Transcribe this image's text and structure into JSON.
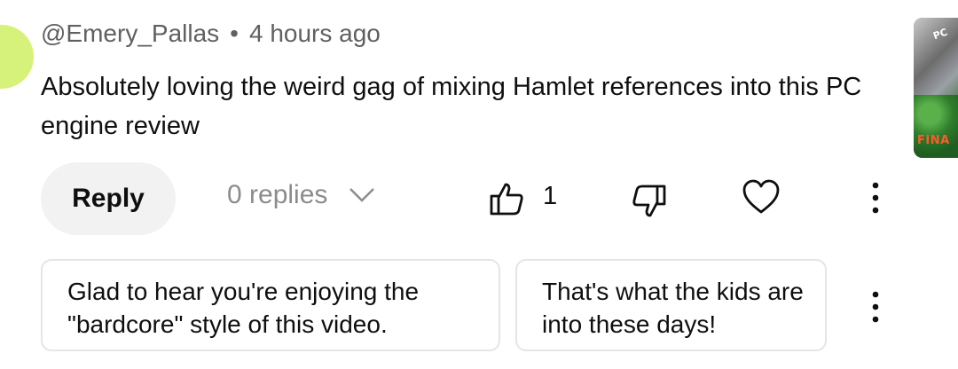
{
  "comment": {
    "author": "@Emery_Pallas",
    "separator": "•",
    "timestamp": "4 hours ago",
    "text": "Absolutely loving the weird gag of mixing Hamlet references into this PC engine review"
  },
  "actions": {
    "reply_label": "Reply",
    "replies_label": "0 replies",
    "like_count": "1"
  },
  "suggested_replies": [
    {
      "text": "Glad to hear you're enjoying the \"bardcore\" style of this video."
    },
    {
      "text": "That's what the kids are into these days!"
    }
  ],
  "thumbnail": {
    "text_top": "PC",
    "text_bottom": "FINA"
  },
  "icons": {
    "like": "thumbs-up-icon",
    "dislike": "thumbs-down-icon",
    "heart": "heart-icon",
    "more": "more-vertical-icon",
    "expand": "chevron-down-icon"
  },
  "colors": {
    "text_primary": "#0f0f0f",
    "text_secondary": "#606060",
    "reply_bg": "#f2f2f2",
    "avatar": "#d7f27a"
  }
}
